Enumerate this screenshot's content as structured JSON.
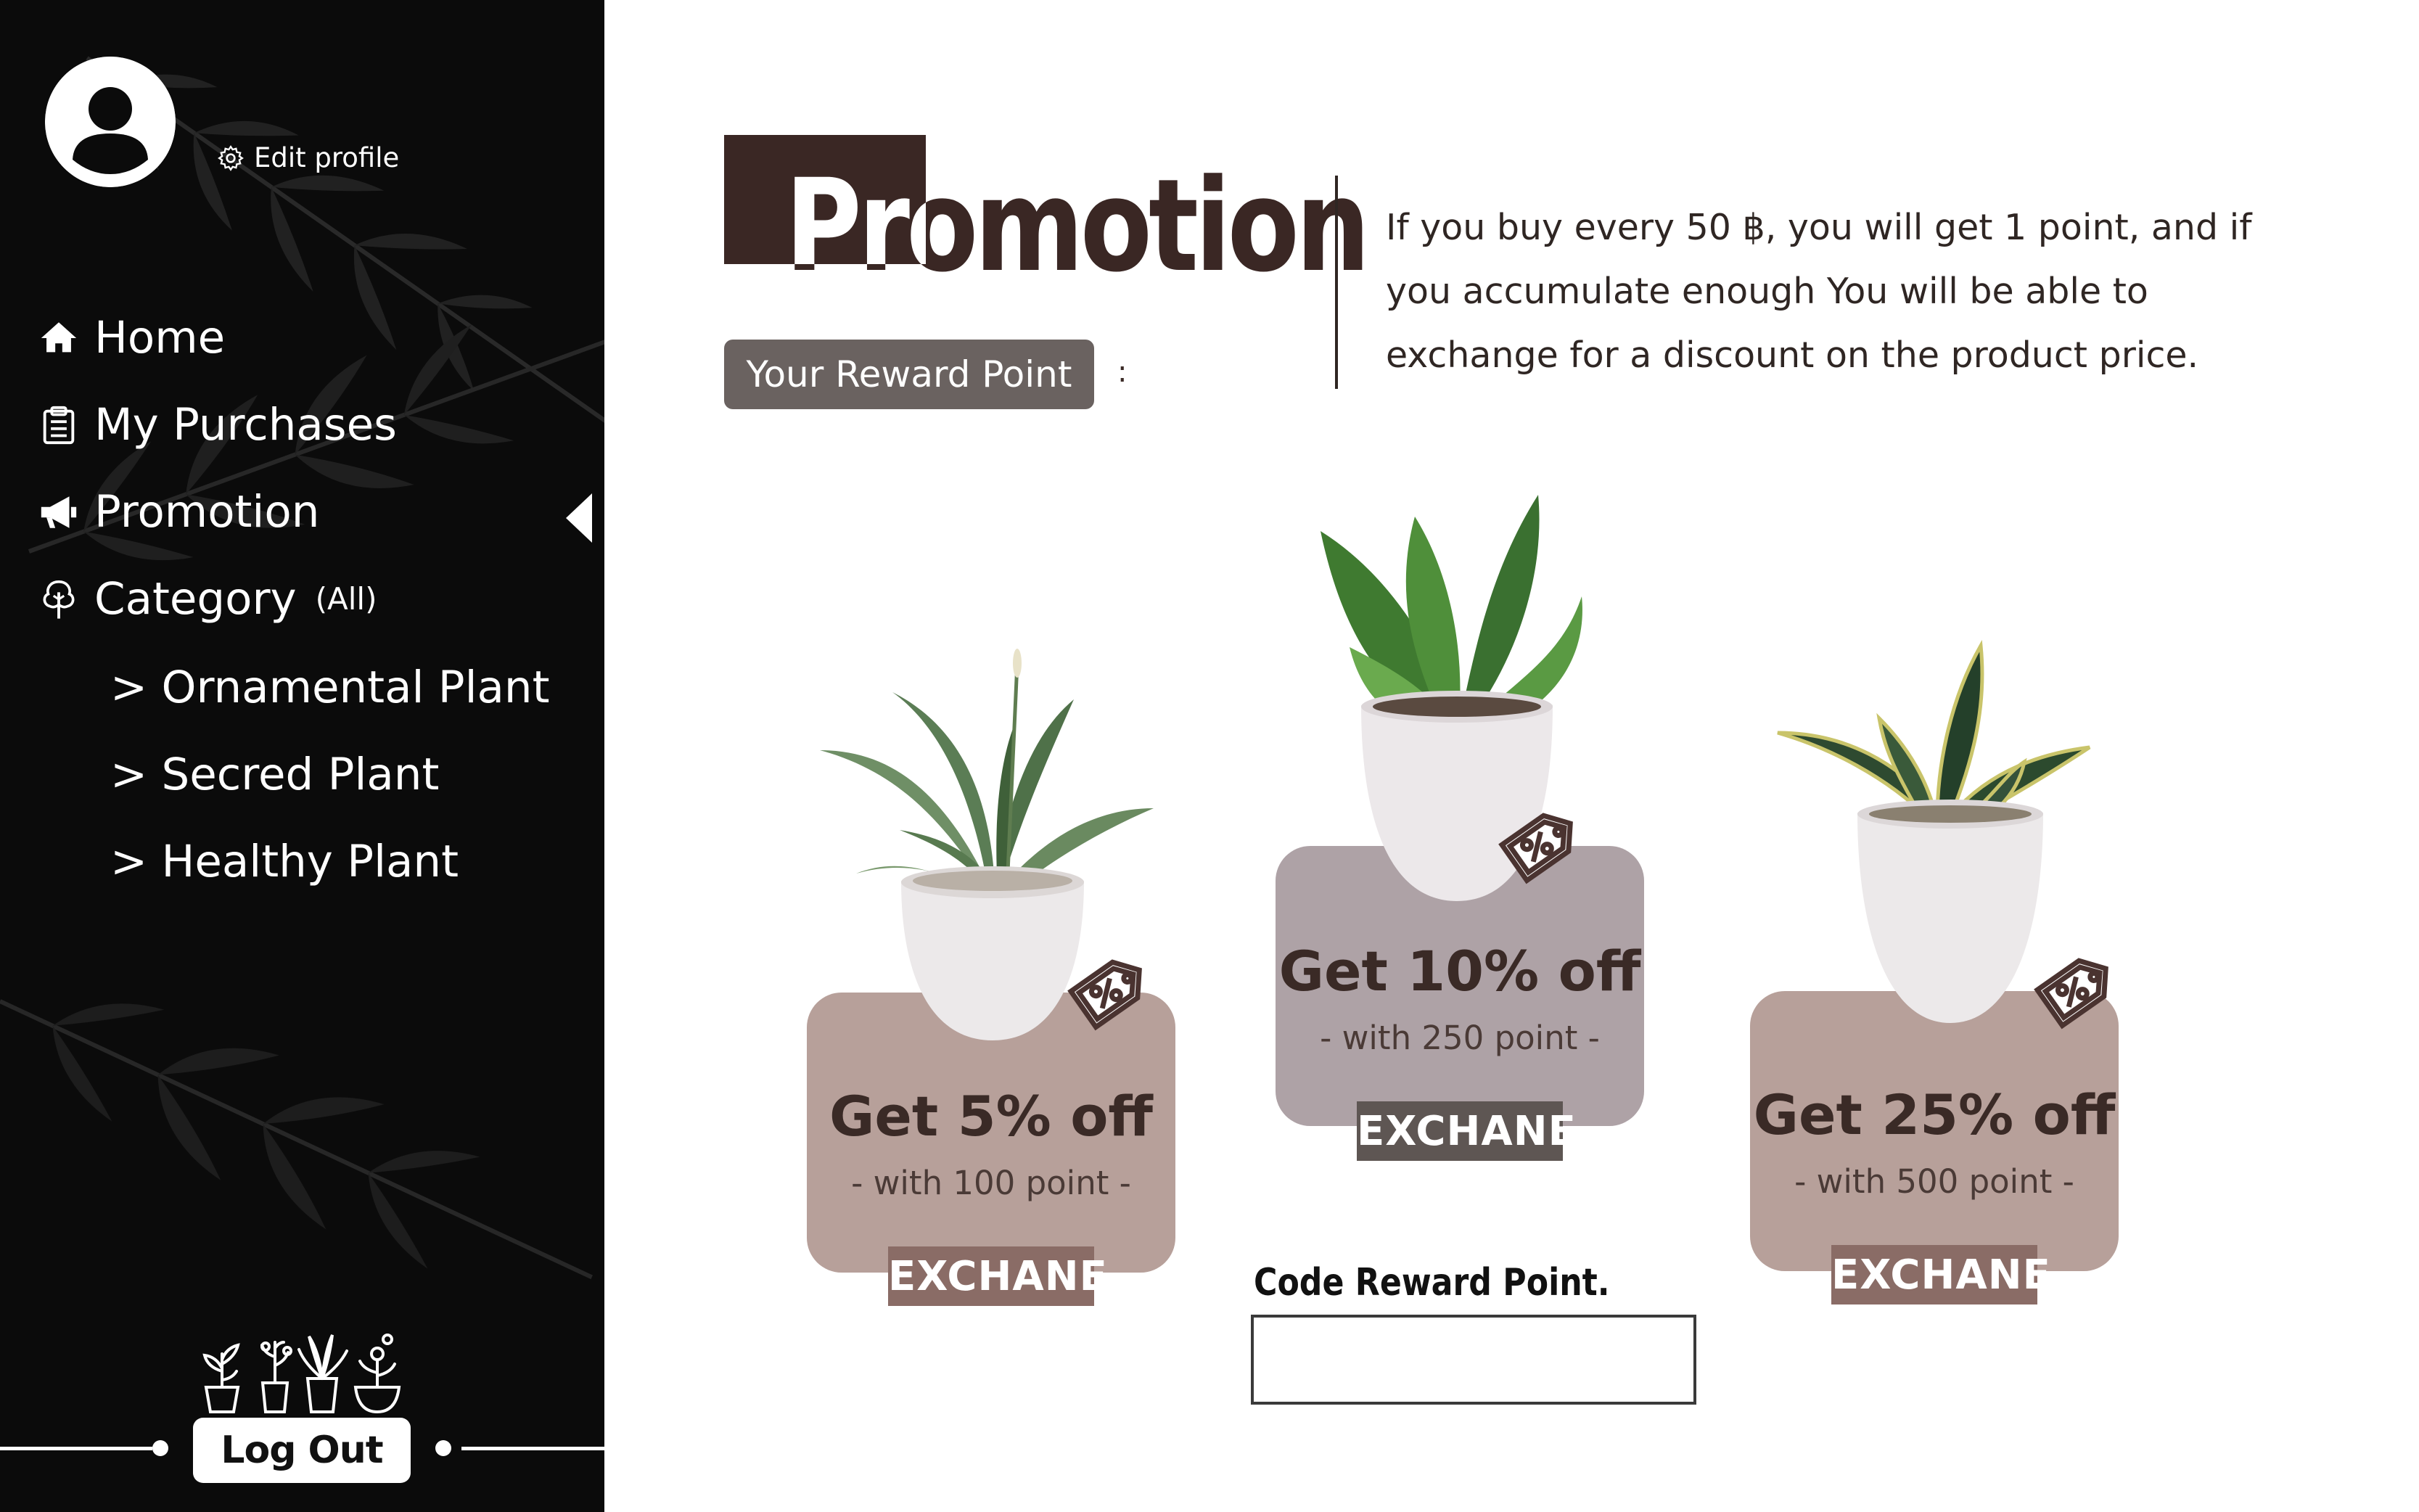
{
  "colors": {
    "sidebar_bg": "#0b0b0b",
    "title_dark": "#3a2724",
    "reward_pill": "#6a6260",
    "card_5": "#b7a09a",
    "card_10": "#aea2a6",
    "card_25": "#b7a09a",
    "btn_5": "#8a6c66",
    "btn_10": "#5e5653",
    "btn_25": "#8a6c66"
  },
  "sidebar": {
    "avatar_icon": "user-avatar-icon",
    "edit_profile": "Edit profile",
    "nav": [
      {
        "label": "Home",
        "icon": "home-icon"
      },
      {
        "label": "My Purchases",
        "icon": "clipboard-icon"
      },
      {
        "label": "Promotion",
        "icon": "megaphone-icon",
        "active": true
      },
      {
        "label": "Category",
        "suffix": "(All)",
        "icon": "tree-icon"
      }
    ],
    "sub_items": [
      "> Ornamental Plant",
      "> Secred Plant",
      "> Healthy Plant"
    ],
    "logout": "Log Out"
  },
  "header": {
    "title": "Promotion",
    "reward_label": "Your Reward Point",
    "reward_colon": ":",
    "reward_value": "",
    "info": "If you buy every 50 ฿, you will get 1 point, and if you accumulate enough You will be able to exchange for a discount on the product price."
  },
  "promotions": [
    {
      "title": "Get 5% off",
      "sub": "- with 100 point -",
      "button": "EXCHANE"
    },
    {
      "title": "Get 10% off",
      "sub": "- with 250 point -",
      "button": "EXCHANE"
    },
    {
      "title": "Get 25% off",
      "sub": "- with 500 point -",
      "button": "EXCHANE"
    }
  ],
  "code": {
    "label": "Code Reward Point.",
    "value": "",
    "placeholder": ""
  }
}
